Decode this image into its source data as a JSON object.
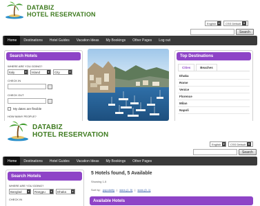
{
  "brand": {
    "line1": "DATABIZ",
    "line2": "HOTEL RESERVATION",
    "logo_icon": "palm-tree-island-icon",
    "color": "#3d7a1e"
  },
  "header": {
    "language": "English",
    "currency": "CSS Default",
    "search_button": "Search"
  },
  "nav": {
    "items": [
      "Home",
      "Destinations",
      "Hotel Guides",
      "Vacation Ideas",
      "My Bookings",
      "Other Pages",
      "Log out"
    ],
    "items_b": [
      "Home",
      "Destinations",
      "Hotel Guides",
      "Vacation Ideas",
      "My Bookings",
      "Other Pages"
    ]
  },
  "search_panel": {
    "title": "Search Hotels",
    "where_label": "WHERE ARE YOU GOING?",
    "country": "Italy",
    "region": "Island",
    "city": "City",
    "country_b": "Banglad",
    "region_b": "Rangpu",
    "city_b": "Dhaka",
    "checkin_label": "CHECK IN",
    "checkout_label": "CHECK OUT",
    "flexible_label": "My dates are flexible",
    "people_label": "HOW MANY PEOPLE?"
  },
  "top_destinations": {
    "title": "Top Destinations",
    "tabs": [
      "Cities",
      "Beaches"
    ],
    "cities": [
      "Dhaka",
      "Rome",
      "Venice",
      "Florence",
      "Milan",
      "Napoli"
    ]
  },
  "results": {
    "title": "5 Hotels found, 5 Available",
    "showing": "Showing 1-5",
    "sort_label": "Sort by:",
    "sort_options": [
      "popularity",
      "stars (1..5)",
      "stars (5..1)"
    ],
    "available_heading": "Available Hotels"
  },
  "colors": {
    "accent": "#8e44c7",
    "nav_bg": "#3a3a3a",
    "brand_green": "#3d7a1e"
  }
}
